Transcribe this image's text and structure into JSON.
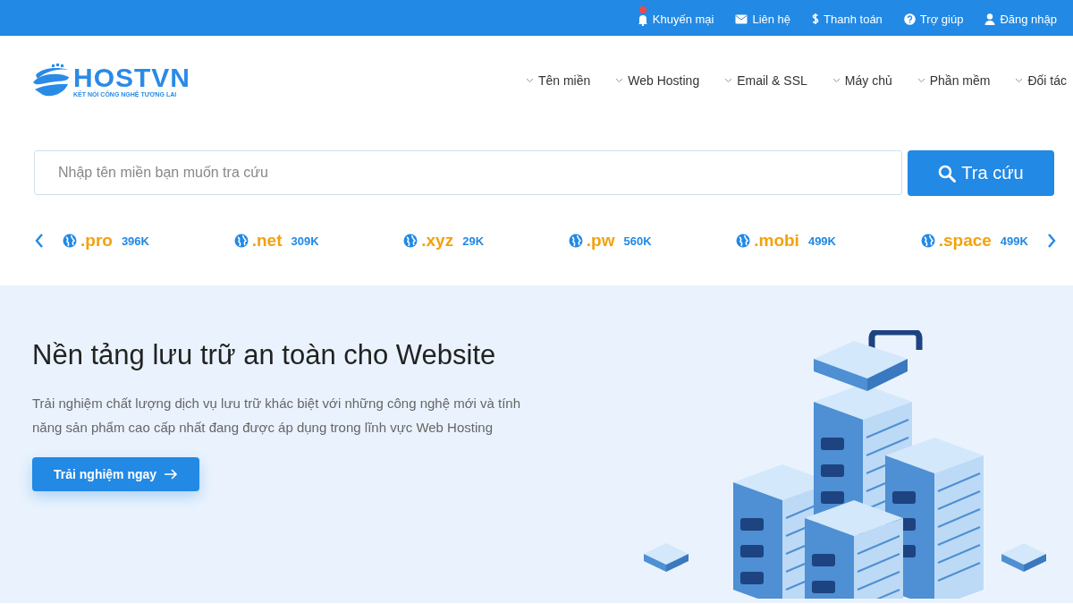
{
  "top_bar": {
    "links": [
      {
        "label": "Khuyến mại",
        "has_notification": true
      },
      {
        "label": "Liên hệ",
        "has_notification": false
      },
      {
        "label": "Thanh toán",
        "has_notification": false
      },
      {
        "label": "Trợ giúp",
        "has_notification": false
      },
      {
        "label": "Đăng nhập",
        "has_notification": false
      }
    ]
  },
  "logo": {
    "name": "HOSTVN",
    "tagline": "KẾT NỐI CÔNG NGHỆ TƯƠNG LAI"
  },
  "nav": [
    "Tên miền",
    "Web Hosting",
    "Email & SSL",
    "Máy chủ",
    "Phần mềm",
    "Đối tác"
  ],
  "search": {
    "placeholder": "Nhập tên miền bạn muốn tra cứu",
    "button": "Tra cứu"
  },
  "domains": [
    {
      "ext": ".pro",
      "price": "396K"
    },
    {
      "ext": ".net",
      "price": "309K"
    },
    {
      "ext": ".xyz",
      "price": "29K"
    },
    {
      "ext": ".pw",
      "price": "560K"
    },
    {
      "ext": ".mobi",
      "price": "499K"
    },
    {
      "ext": ".space",
      "price": "499K"
    }
  ],
  "hero": {
    "title": "Nền tảng lưu trữ an toàn cho Website",
    "text": "Trải nghiệm chất lượng dịch vụ lưu trữ khác biệt với những công nghệ mới và tính năng sản phẩm cao cấp nhất đang được áp dụng trong lĩnh vực Web Hosting",
    "button": "Trải nghiệm ngay"
  }
}
